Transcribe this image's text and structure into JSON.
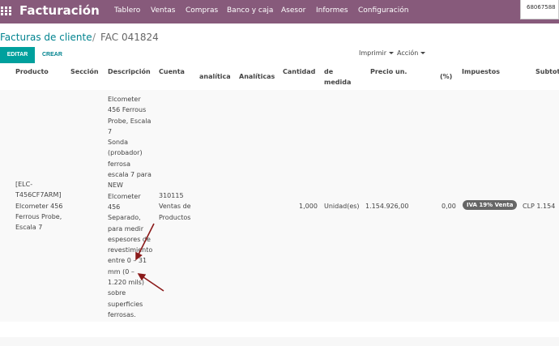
{
  "navbar": {
    "brand": "Facturación",
    "menu": [
      "Tablero",
      "Ventas",
      "Compras",
      "Banco y caja",
      "Asesor",
      "Informes",
      "Configuración"
    ],
    "user_id": "68067588"
  },
  "breadcrumb": {
    "parent": "Facturas de cliente",
    "separator": "/",
    "current": "FAC 041824"
  },
  "toolbar": {
    "edit_label": "EDITAR",
    "create_label": "CREAR",
    "print_label": "Imprimir",
    "action_label": "Acción"
  },
  "table": {
    "headers": {
      "product": "Producto",
      "section": "Sección",
      "description": "Descripción",
      "account": "Cuenta",
      "analytic_1": "analítica",
      "analytic_2": "Analíticas",
      "quantity": "Cantidad",
      "uom": "de",
      "uom_2": "medida",
      "price": "Precio un.",
      "discount": "(%)",
      "taxes": "Impuestos",
      "subtotal": "Subtot"
    },
    "row": {
      "product_lines": [
        "[ELC-",
        "T456CF7ARM]",
        "Elcometer 456",
        "Ferrous Probe,",
        "Escala 7"
      ],
      "description_lines": [
        "Elcometer",
        "456 Ferrous",
        "Probe, Escala",
        "7",
        "Sonda",
        "(probador)",
        "ferrosa",
        "escala 7 para",
        "NEW",
        "Elcometer",
        "456",
        "Separado,",
        "para medir",
        "espesores de",
        "revestimiento",
        "entre 0 – 31",
        "mm (0 –",
        "1.220 mils)",
        "sobre",
        "superficies",
        "ferrosas."
      ],
      "account_lines": [
        "310115",
        "Ventas de",
        "Productos"
      ],
      "quantity": "1,000",
      "uom": "Unidad(es)",
      "price": "1.154.926,00",
      "discount": "0,00",
      "tax_badge": "IVA 19% Venta",
      "subtotal": "CLP 1.154"
    }
  },
  "colors": {
    "navbar": "#875a7b",
    "primary_button": "#00a09d",
    "link": "#00838f",
    "badge": "#666666",
    "annotation_arrow": "#8b1a1a"
  }
}
